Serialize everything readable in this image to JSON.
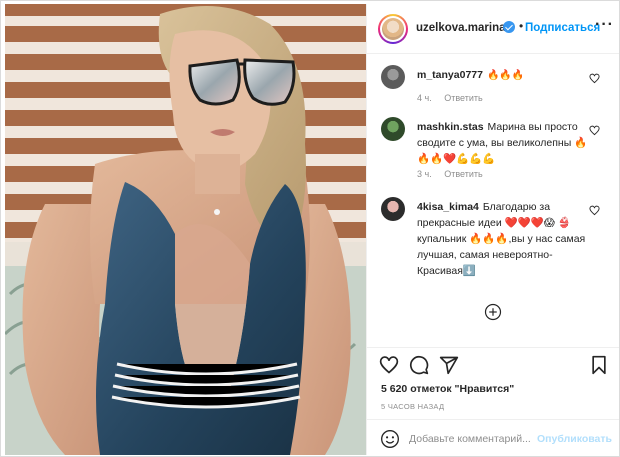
{
  "post": {
    "username": "uzelkova.marina",
    "separator": "•",
    "follow_label": "Подписаться",
    "more_label": "···"
  },
  "comments": [
    {
      "user": "m_tanya0777",
      "text": "🔥🔥🔥",
      "time": "4 ч.",
      "reply_label": "Ответить"
    },
    {
      "user": "mashkin.stas",
      "text": "Марина вы просто сводите с ума, вы великолепны 🔥🔥🔥❤️💪💪💪",
      "time": "3 ч.",
      "reply_label": "Ответить"
    },
    {
      "user": "4kisa_kima4",
      "text": "Благодарю за прекрасные идеи ❤️❤️❤️😱 👙купальник 🔥🔥🔥,вы у нас самая лучшая, самая невероятно- Красивая⬇️",
      "time": "",
      "reply_label": ""
    }
  ],
  "actions": {
    "likes_text": "5 620 отметок \"Нравится\"",
    "time_ago": "5 ЧАСОВ НАЗАД"
  },
  "add_comment": {
    "placeholder": "Добавьте комментарий...",
    "publish_label": "Опубликовать"
  },
  "icons": {
    "header": [
      "verified-badge-icon",
      "more-options-icon"
    ],
    "actions": [
      "heart-icon",
      "comment-icon",
      "share-icon",
      "bookmark-icon"
    ],
    "other": [
      "plus-circle-icon",
      "emoji-icon",
      "small-heart-icon"
    ]
  },
  "colors": {
    "accent": "#0095f6",
    "publish_disabled": "#b2dffc",
    "meta_text": "#8e8e8e",
    "border": "#efefef",
    "swimsuit": "#2a4a63"
  }
}
